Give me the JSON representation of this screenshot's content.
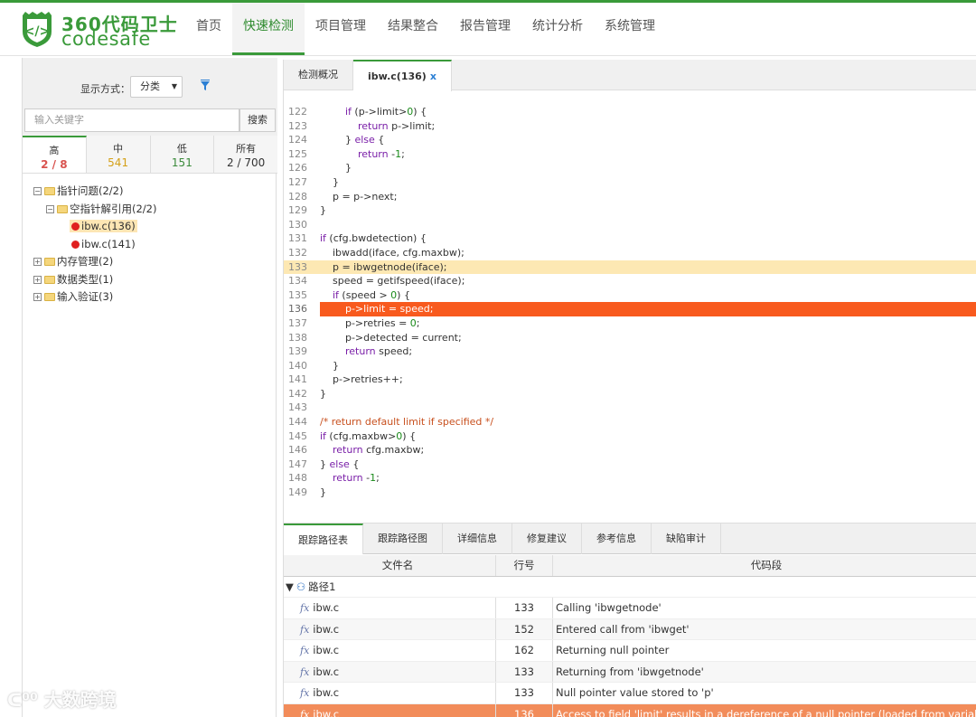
{
  "brand": {
    "name_cn": "360代码卫士",
    "name_en": "codesafe"
  },
  "nav": [
    {
      "label": "首页",
      "active": false
    },
    {
      "label": "快速检测",
      "active": true
    },
    {
      "label": "项目管理",
      "active": false
    },
    {
      "label": "结果整合",
      "active": false
    },
    {
      "label": "报告管理",
      "active": false
    },
    {
      "label": "统计分析",
      "active": false
    },
    {
      "label": "系统管理",
      "active": false
    }
  ],
  "left": {
    "display_label": "显示方式：",
    "display_value": "分类",
    "search_placeholder": "输入关键字",
    "search_button": "搜索",
    "severity_tabs": [
      {
        "label": "高",
        "count": "2 / 8",
        "color": "#d9534f"
      },
      {
        "label": "中",
        "count": "541",
        "color": "#d4a017"
      },
      {
        "label": "低",
        "count": "151",
        "color": "#3a8a3a"
      },
      {
        "label": "所有",
        "count": "2 / 700",
        "color": "#333333"
      }
    ],
    "tree": {
      "pointer": "指针问题(2/2)",
      "nullref": "空指针解引用(2/2)",
      "file1": "ibw.c(136)",
      "file2": "ibw.c(141)",
      "memory": "内存管理(2)",
      "datatype": "数据类型(1)",
      "input": "输入验证(3)"
    }
  },
  "tabs": [
    {
      "label": "检测概况"
    },
    {
      "label": "ibw.c(136)",
      "close": "x"
    }
  ],
  "code": [
    {
      "n": "122",
      "t": "        if (p->limit>0) {"
    },
    {
      "n": "123",
      "t": "            return p->limit;"
    },
    {
      "n": "124",
      "t": "        } else {"
    },
    {
      "n": "125",
      "t": "            return -1;"
    },
    {
      "n": "126",
      "t": "        }"
    },
    {
      "n": "127",
      "t": "    }"
    },
    {
      "n": "128",
      "t": "    p = p->next;"
    },
    {
      "n": "129",
      "t": "}"
    },
    {
      "n": "130",
      "t": ""
    },
    {
      "n": "131",
      "t": "if (cfg.bwdetection) {"
    },
    {
      "n": "132",
      "t": "    ibwadd(iface, cfg.maxbw);"
    },
    {
      "n": "133",
      "t": "    p = ibwgetnode(iface);"
    },
    {
      "n": "134",
      "t": "    speed = getifspeed(iface);"
    },
    {
      "n": "135",
      "t": "    if (speed > 0) {"
    },
    {
      "n": "136",
      "t": "        p->limit = speed;"
    },
    {
      "n": "137",
      "t": "        p->retries = 0;"
    },
    {
      "n": "138",
      "t": "        p->detected = current;"
    },
    {
      "n": "139",
      "t": "        return speed;"
    },
    {
      "n": "140",
      "t": "    }"
    },
    {
      "n": "141",
      "t": "    p->retries++;"
    },
    {
      "n": "142",
      "t": "}"
    },
    {
      "n": "143",
      "t": ""
    },
    {
      "n": "144",
      "t": "/* return default limit if specified */"
    },
    {
      "n": "145",
      "t": "if (cfg.maxbw>0) {"
    },
    {
      "n": "146",
      "t": "    return cfg.maxbw;"
    },
    {
      "n": "147",
      "t": "} else {"
    },
    {
      "n": "148",
      "t": "    return -1;"
    },
    {
      "n": "149",
      "t": "}"
    }
  ],
  "bottom_tabs": [
    "跟踪路径表",
    "跟踪路径图",
    "详细信息",
    "修复建议",
    "参考信息",
    "缺陷审计"
  ],
  "table": {
    "headers": {
      "file": "文件名",
      "line": "行号",
      "code": "代码段"
    },
    "path_label": "路径1",
    "rows": [
      {
        "file": "ibw.c",
        "line": "133",
        "code": "Calling 'ibwgetnode'"
      },
      {
        "file": "ibw.c",
        "line": "152",
        "code": "Entered call from 'ibwget'"
      },
      {
        "file": "ibw.c",
        "line": "162",
        "code": "Returning null pointer"
      },
      {
        "file": "ibw.c",
        "line": "133",
        "code": "Returning from 'ibwgetnode'"
      },
      {
        "file": "ibw.c",
        "line": "133",
        "code": "Null pointer value stored to 'p'"
      },
      {
        "file": "ibw.c",
        "line": "136",
        "code": "Access to field 'limit' results in a dereference of a null pointer (loaded from variable 'p')"
      }
    ]
  },
  "watermark": "大数跨境"
}
